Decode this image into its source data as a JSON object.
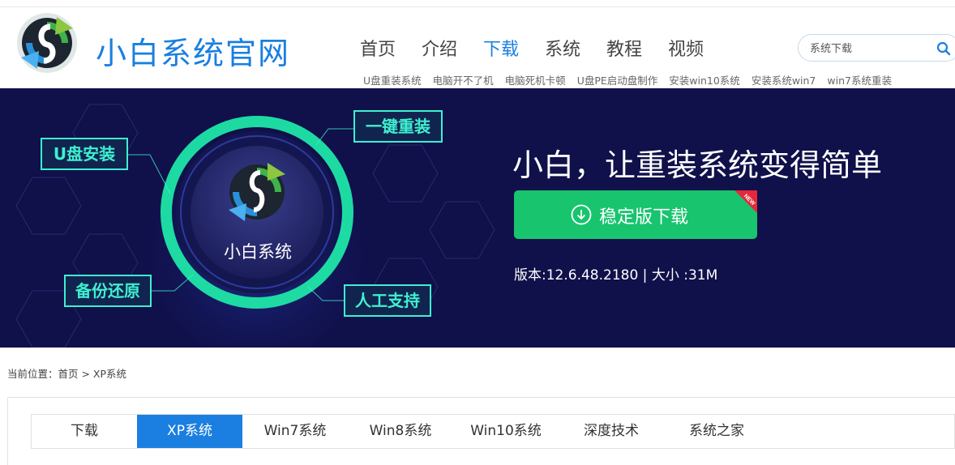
{
  "brand": {
    "name": "小白系统官网"
  },
  "nav": {
    "items": [
      {
        "label": "首页",
        "active": false
      },
      {
        "label": "介绍",
        "active": false
      },
      {
        "label": "下载",
        "active": true
      },
      {
        "label": "系统",
        "active": false
      },
      {
        "label": "教程",
        "active": false
      },
      {
        "label": "视频",
        "active": false
      }
    ]
  },
  "search": {
    "placeholder": "系统下载"
  },
  "sublinks": [
    "U盘重装系统",
    "电脑开不了机",
    "电脑死机卡顿",
    "U盘PE启动盘制作",
    "安装win10系统",
    "安装系统win7",
    "win7系统重装"
  ],
  "banner": {
    "core_label": "小白系统",
    "tags": {
      "onekey": "一键重装",
      "usb": "U盘安装",
      "backup": "备份还原",
      "support": "人工支持"
    },
    "slogan": "小白，让重装系统变得简单",
    "download_label": "稳定版下载",
    "new_badge": "NEW",
    "version": "版本:12.6.48.2180  |  大小 :31M"
  },
  "breadcrumb": "当前位置：首页 > XP系统",
  "tabs": [
    {
      "label": "下载",
      "active": false
    },
    {
      "label": "XP系统",
      "active": true
    },
    {
      "label": "Win7系统",
      "active": false
    },
    {
      "label": "Win8系统",
      "active": false
    },
    {
      "label": "Win10系统",
      "active": false
    },
    {
      "label": "深度技术",
      "active": false
    },
    {
      "label": "系统之家",
      "active": false
    }
  ],
  "colors": {
    "brand_blue": "#1a7fe0",
    "banner_bg": "#10104a",
    "download_green": "#18c46e",
    "tag_cyan": "#3ef0d0",
    "new_red": "#e5283c"
  }
}
